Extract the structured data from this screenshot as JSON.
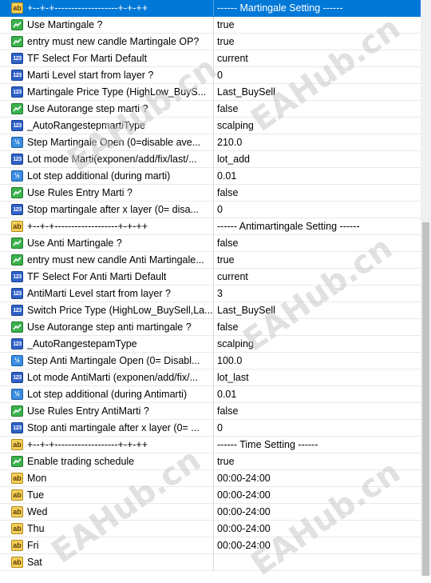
{
  "rows": [
    {
      "icon": "ab",
      "name": "+--+-+-------------------+-+-++",
      "value": "------ Martingale Setting ------",
      "selected": true
    },
    {
      "icon": "bool",
      "name": "Use Martingale ?",
      "value": "true"
    },
    {
      "icon": "bool",
      "name": "entry must new candle Martingale OP?",
      "value": "true"
    },
    {
      "icon": "n123",
      "name": "TF Select For Marti Default",
      "value": "current"
    },
    {
      "icon": "n123",
      "name": "Marti Level start from layer ?",
      "value": "0"
    },
    {
      "icon": "n123",
      "name": "Martingale Price Type (HighLow_BuyS...",
      "value": "Last_BuySell"
    },
    {
      "icon": "bool",
      "name": "Use Autorange step marti ?",
      "value": "false"
    },
    {
      "icon": "n123",
      "name": "_AutoRangestepmartiType",
      "value": "scalping"
    },
    {
      "icon": "v2",
      "name": "Step Martingale Open (0=disable ave...",
      "value": "210.0"
    },
    {
      "icon": "n123",
      "name": "Lot mode Marti(exponen/add/fix/last/...",
      "value": "lot_add"
    },
    {
      "icon": "v2",
      "name": "Lot step additional (during marti)",
      "value": "0.01"
    },
    {
      "icon": "bool",
      "name": "Use Rules Entry Marti ?",
      "value": "false"
    },
    {
      "icon": "n123",
      "name": "Stop martingale after x layer (0= disa...",
      "value": "0"
    },
    {
      "icon": "ab",
      "name": "+--+-+-------------------+-+-++",
      "value": "------ Antimartingale Setting ------"
    },
    {
      "icon": "bool",
      "name": "Use Anti Martingale ?",
      "value": "false"
    },
    {
      "icon": "bool",
      "name": "entry must new candle Anti Martingale...",
      "value": "true"
    },
    {
      "icon": "n123",
      "name": "TF Select For Anti Marti Default",
      "value": "current"
    },
    {
      "icon": "n123",
      "name": "AntiMarti Level start from layer  ?",
      "value": "3"
    },
    {
      "icon": "n123",
      "name": "Switch Price Type (HighLow_BuySell,La...",
      "value": "Last_BuySell"
    },
    {
      "icon": "bool",
      "name": "Use Autorange step anti martingale ?",
      "value": "false"
    },
    {
      "icon": "n123",
      "name": "_AutoRangestepamType",
      "value": "scalping"
    },
    {
      "icon": "v2",
      "name": "Step Anti Martingale Open (0= Disabl...",
      "value": "100.0"
    },
    {
      "icon": "n123",
      "name": "Lot mode AntiMarti (exponen/add/fix/...",
      "value": "lot_last"
    },
    {
      "icon": "v2",
      "name": "Lot step additional (during Antimarti)",
      "value": "0.01"
    },
    {
      "icon": "bool",
      "name": "Use Rules Entry AntiMarti ?",
      "value": "false"
    },
    {
      "icon": "n123",
      "name": "Stop anti martingale after x layer (0= ...",
      "value": "0"
    },
    {
      "icon": "ab",
      "name": "+--+-+-------------------+-+-++",
      "value": "------ Time Setting ------"
    },
    {
      "icon": "bool",
      "name": "Enable trading schedule",
      "value": "true"
    },
    {
      "icon": "ab",
      "name": "Mon",
      "value": "00:00-24:00"
    },
    {
      "icon": "ab",
      "name": "Tue",
      "value": "00:00-24:00"
    },
    {
      "icon": "ab",
      "name": "Wed",
      "value": "00:00-24:00"
    },
    {
      "icon": "ab",
      "name": "Thu",
      "value": "00:00-24:00"
    },
    {
      "icon": "ab",
      "name": "Fri",
      "value": "00:00-24:00"
    },
    {
      "icon": "ab",
      "name": "Sat",
      "value": ""
    }
  ],
  "icon_glyphs": {
    "ab": "ab",
    "n123": "123",
    "v2": "½"
  },
  "watermark_text": "EAHub.cn",
  "colors": {
    "selected": "#0078d7",
    "ab": "#f5cf5a",
    "n123": "#2f62c9",
    "v2": "#3a8de0",
    "bool": "#3bb14c"
  }
}
